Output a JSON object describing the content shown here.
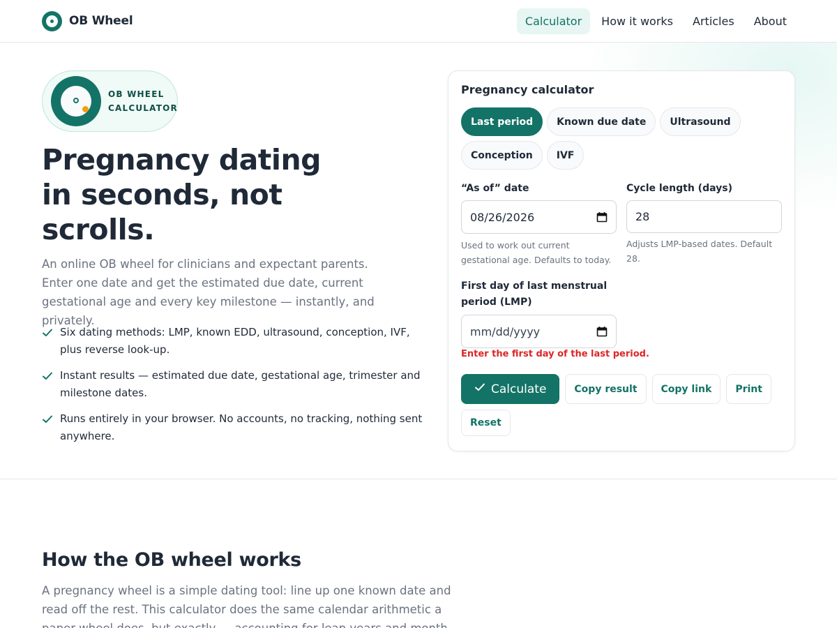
{
  "header": {
    "brand": "OB Wheel",
    "nav": [
      "Calculator",
      "How it works",
      "Articles",
      "About"
    ]
  },
  "hero": {
    "badge_line1": "OB WHEEL",
    "badge_line2": "CALCULATOR",
    "title_line1": "Pregnancy dating",
    "title_line2": "in seconds, not",
    "title_line3": "scrolls.",
    "subtitle": "An online OB wheel for clinicians and expectant parents. Enter one date and get the estimated due date, current gestational age and every key milestone — instantly, and privately.",
    "features": [
      "Six dating methods: LMP, known EDD, ultrasound, conception, IVF, plus reverse look-up.",
      "Instant results — estimated due date, gestational age, trimester and milestone dates.",
      "Runs entirely in your browser. No accounts, no tracking, nothing sent anywhere."
    ]
  },
  "calculator": {
    "title": "Pregnancy calculator",
    "methods": [
      "Last period",
      "Known due date",
      "Ultrasound",
      "Conception",
      "IVF"
    ],
    "active_method": "Last period",
    "as_of_label": "“As of” date",
    "as_of_value": "08/26/2026",
    "as_of_hint": "Used to work out current gestational age. Defaults to today.",
    "cycle_label": "Cycle length (days)",
    "cycle_value": "28",
    "cycle_hint": "Adjusts LMP-based dates. Default 28.",
    "lmp_label": "First day of last menstrual period (LMP)",
    "lmp_placeholder": "mm/dd/yyyy",
    "lmp_error": "Enter the first day of the last period.",
    "buttons": {
      "calculate": "Calculate",
      "copy_result": "Copy result",
      "copy_link": "Copy link",
      "print": "Print",
      "reset": "Reset"
    }
  },
  "how": {
    "title": "How the OB wheel works",
    "body": "A pregnancy wheel is a simple dating tool: line up one known date and read off the rest. This calculator does the same calendar arithmetic a paper wheel does, but exactly — accounting for leap years and month lengths — and lets"
  },
  "colors": {
    "accent": "#137366",
    "accent_light": "#e7f6f2",
    "error": "#dc2626",
    "badge_dot": "#f59e0b"
  },
  "icons": {
    "brand": "wheel-logo-icon",
    "feature": "check-icon",
    "date_picker": "calendar-icon",
    "calculate": "check-icon"
  }
}
